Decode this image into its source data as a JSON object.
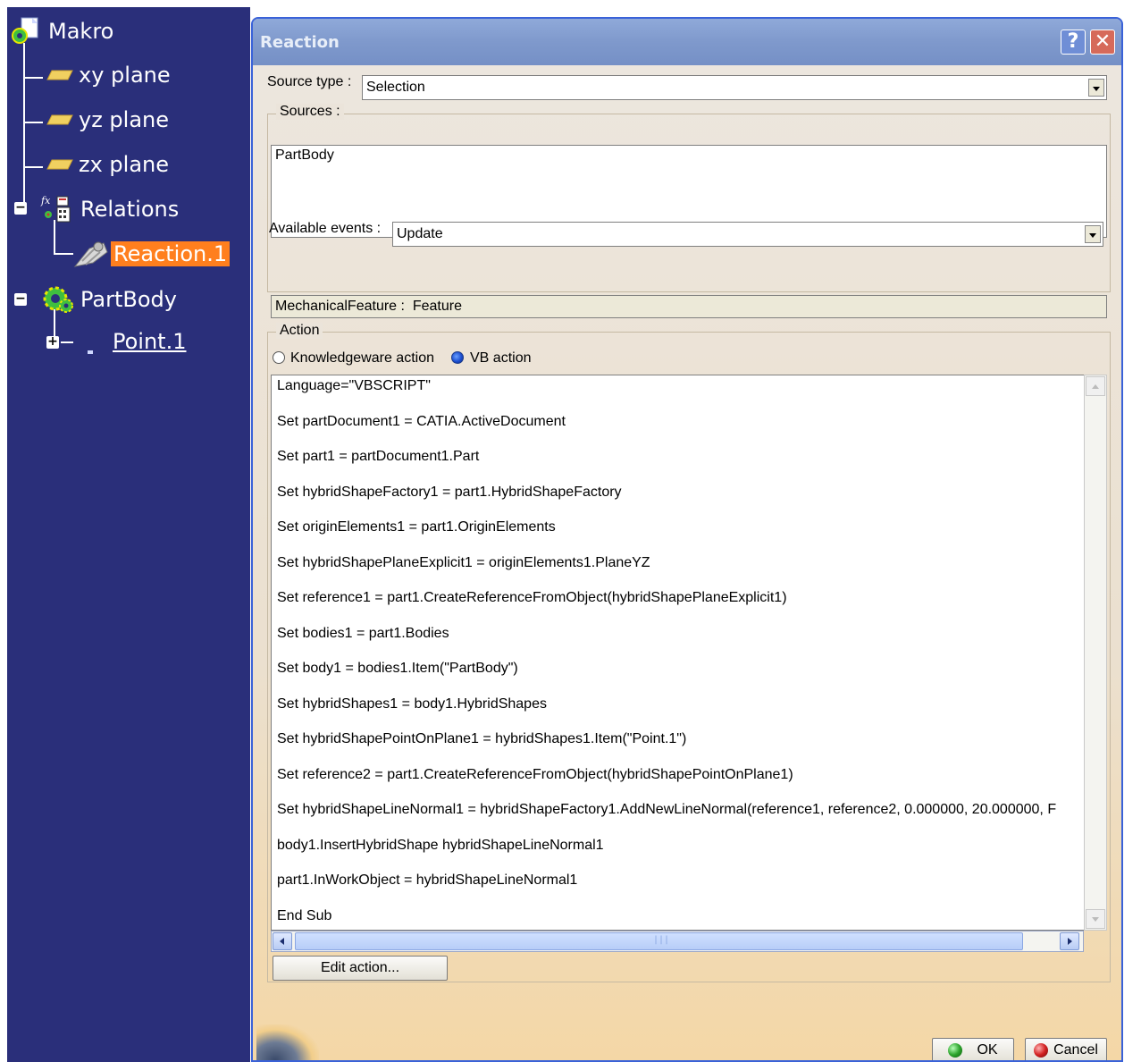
{
  "tree": {
    "root": "Makro",
    "items": [
      {
        "label": "xy plane"
      },
      {
        "label": "yz plane"
      },
      {
        "label": "zx plane"
      },
      {
        "label": "Relations"
      },
      {
        "label": "Reaction.1"
      },
      {
        "label": "PartBody"
      },
      {
        "label": "Point.1"
      }
    ],
    "colors": {
      "background": "#2a2f7a",
      "selected": "#ff7f1e"
    }
  },
  "dialog": {
    "title": "Reaction",
    "help_glyph": "?",
    "close_glyph": "✕",
    "source_type_label": "Source type :",
    "source_type_value": "Selection",
    "sources_label": "Sources :",
    "sources_value": "PartBody",
    "events_label": "Available events :",
    "events_value": "Update",
    "mechanical_feature": "MechanicalFeature :  Feature",
    "action_label": "Action",
    "radio_knowledgeware": "Knowledgeware action",
    "radio_vb": "VB action",
    "selected_action": "VB action",
    "code_lines": [
      "Language=\"VBSCRIPT\"",
      "Set partDocument1 = CATIA.ActiveDocument",
      "Set part1 = partDocument1.Part",
      "Set hybridShapeFactory1 = part1.HybridShapeFactory",
      "Set originElements1 = part1.OriginElements",
      "Set hybridShapePlaneExplicit1 = originElements1.PlaneYZ",
      "Set reference1 = part1.CreateReferenceFromObject(hybridShapePlaneExplicit1)",
      "Set bodies1 = part1.Bodies",
      "Set body1 = bodies1.Item(\"PartBody\")",
      "Set hybridShapes1 = body1.HybridShapes",
      "Set hybridShapePointOnPlane1 = hybridShapes1.Item(\"Point.1\")",
      "Set reference2 = part1.CreateReferenceFromObject(hybridShapePointOnPlane1)",
      "Set hybridShapeLineNormal1 = hybridShapeFactory1.AddNewLineNormal(reference1, reference2, 0.000000, 20.000000, F",
      "body1.InsertHybridShape hybridShapeLineNormal1",
      "part1.InWorkObject = hybridShapeLineNormal1",
      "End Sub"
    ],
    "edit_action_label": "Edit action...",
    "ok_label": "OK",
    "cancel_label": "Cancel",
    "colors": {
      "titlebar": "#7f99cc",
      "accent_border": "#3a62d8"
    }
  }
}
